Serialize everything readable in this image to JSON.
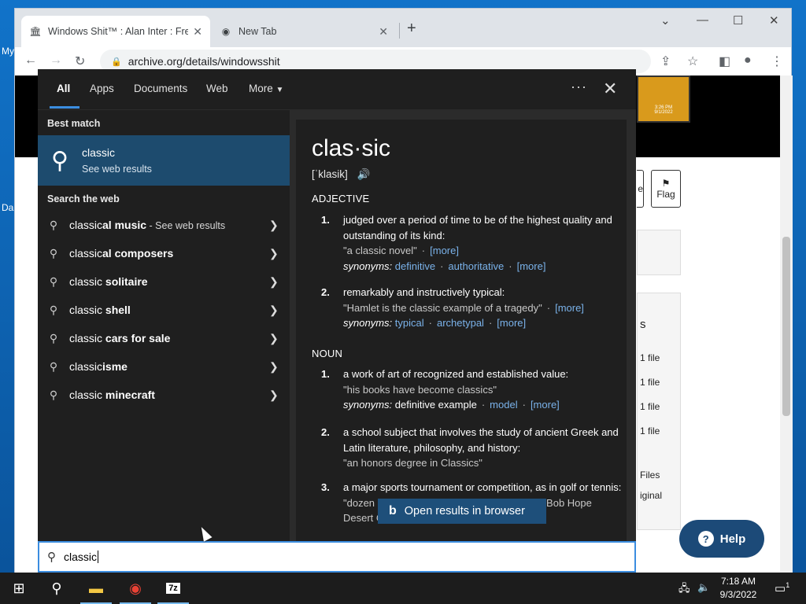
{
  "desktop": {
    "icon_label_1": "My",
    "icon_label_2": "Da"
  },
  "browser": {
    "tabs": [
      {
        "title": "Windows Shit™ : Alan Inter : Frec",
        "favicon": "archive-icon"
      },
      {
        "title": "New Tab",
        "favicon": "chrome-icon"
      }
    ],
    "url": "archive.org/details/windowsshit",
    "page": {
      "flag_label": "Flag",
      "partial_button_label": "e",
      "section_partial": "s",
      "file_rows": [
        "1 file",
        "1 file",
        "1 file",
        "1 file"
      ],
      "files_label": "Files",
      "original_label": "iginal",
      "help_label": "Help",
      "thumb_time": "3:26 PM",
      "thumb_date": "9/1/2022"
    }
  },
  "search": {
    "tabs": [
      "All",
      "Apps",
      "Documents",
      "Web",
      "More"
    ],
    "best_match_header": "Best match",
    "best_match": {
      "title": "classic",
      "subtitle": "See web results"
    },
    "search_web_header": "Search the web",
    "suggestions": [
      {
        "prefix": "classic",
        "bold": "al music",
        "suffix": " - See web results"
      },
      {
        "prefix": "classic",
        "bold": "al composers",
        "suffix": ""
      },
      {
        "prefix": "classic ",
        "bold": "solitaire",
        "suffix": ""
      },
      {
        "prefix": "classic ",
        "bold": "shell",
        "suffix": ""
      },
      {
        "prefix": "classic ",
        "bold": "cars for sale",
        "suffix": ""
      },
      {
        "prefix": "classic",
        "bold": "isme",
        "suffix": ""
      },
      {
        "prefix": "classic ",
        "bold": "minecraft",
        "suffix": ""
      }
    ],
    "definition": {
      "word": "clas·sic",
      "pronunciation": "[ˈklasik]",
      "adjective_label": "ADJECTIVE",
      "noun_label": "NOUN",
      "synonyms_label": "synonyms:",
      "more_label": "[more]",
      "adj1_num": "1.",
      "adj1_text": "judged over a period of time to be of the highest quality and outstanding of its kind:",
      "adj1_example": "\"a classic novel\"",
      "adj1_syn1": "definitive",
      "adj1_syn2": "authoritative",
      "adj2_num": "2.",
      "adj2_text": "remarkably and instructively typical:",
      "adj2_example": "\"Hamlet is the classic example of a tragedy\"",
      "adj2_syn1": "typical",
      "adj2_syn2": "archetypal",
      "noun1_num": "1.",
      "noun1_text": "a work of art of recognized and established value:",
      "noun1_example": "\"his books have become classics\"",
      "noun1_syn1": "definitive example",
      "noun1_syn2": "model",
      "noun2_num": "2.",
      "noun2_text": "a school subject that involves the study of ancient Greek and Latin literature, philosophy, and history:",
      "noun2_example": "\"an honors degree in Classics\"",
      "noun3_num": "3.",
      "noun3_text": "a major sports tournament or competition, as in golf or tennis:",
      "noun3_example_start": "\"dozen",
      "noun3_example_end": "Bob Hope",
      "noun3_example_line2": "Desert Classic\""
    },
    "open_browser_label": "Open results in browser",
    "query": "classic"
  },
  "taskbar": {
    "time": "7:18 AM",
    "date": "9/3/2022",
    "notification_count": "1",
    "apps": [
      "start-icon",
      "search-icon",
      "file-explorer-icon",
      "chrome-icon",
      "7zip-icon"
    ],
    "sevenzip_label": "7z"
  }
}
